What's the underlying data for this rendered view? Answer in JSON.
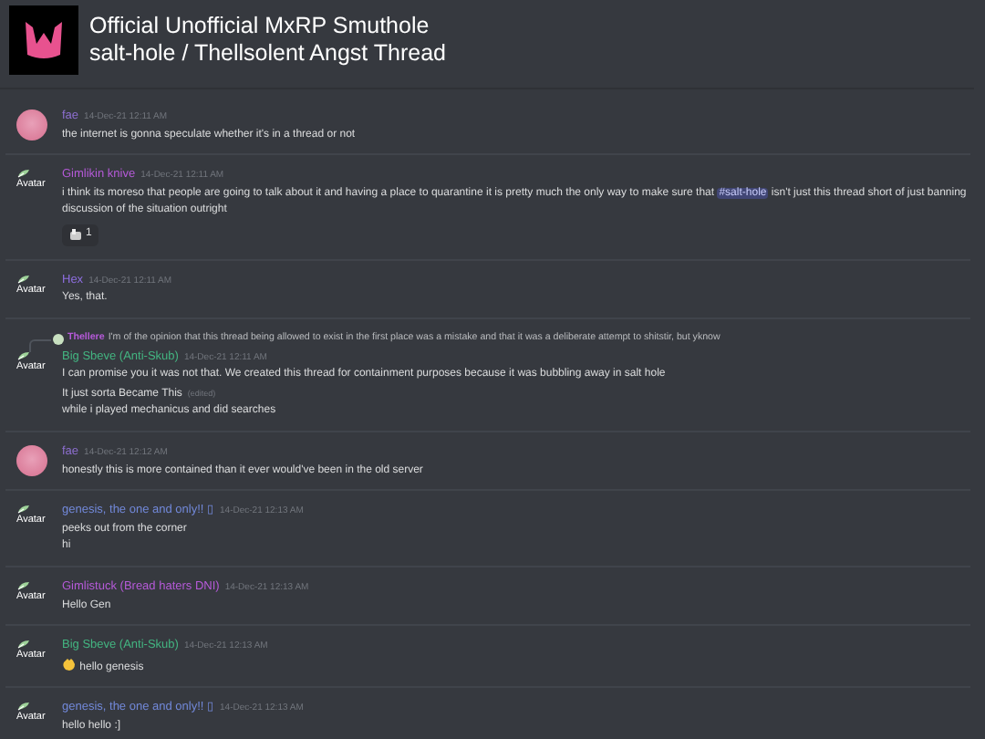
{
  "header": {
    "server": "Official Unofficial MxRP Smuthole",
    "channel": "salt-hole / Thellsolent Angst Thread"
  },
  "messages": [
    {
      "author": "fae",
      "color": "#8e6fd1",
      "avatar": {
        "kind": "photo"
      },
      "timestamp": "14-Dec-21 12:11 AM",
      "lines": [
        {
          "parts": [
            {
              "kind": "plain",
              "text": "the internet is gonna speculate whether it's in a thread or not"
            }
          ]
        }
      ]
    },
    {
      "author": "Gimlikin knive",
      "color": "#b65ad9",
      "avatar": {
        "kind": "broken",
        "alt": "Avatar"
      },
      "timestamp": "14-Dec-21 12:11 AM",
      "lines": [
        {
          "parts": [
            {
              "kind": "plain",
              "text": "i think its moreso that people are going to talk about it and having a place to quarantine it is pretty much the only way to make sure that "
            },
            {
              "kind": "mention",
              "text": "#salt-hole"
            },
            {
              "kind": "plain",
              "text": " isn't just this thread short of just banning discussion of the situation outright"
            }
          ]
        }
      ],
      "reaction": {
        "count": "1"
      }
    },
    {
      "author": "Hex",
      "color": "#8e6ee0",
      "avatar": {
        "kind": "broken",
        "alt": "Avatar"
      },
      "timestamp": "14-Dec-21 12:11 AM",
      "lines": [
        {
          "parts": [
            {
              "kind": "plain",
              "text": "Yes, that."
            }
          ]
        }
      ]
    },
    {
      "author": "Big Sbeve (Anti-Skub)",
      "color": "#43b581",
      "avatar": {
        "kind": "broken",
        "alt": "Avatar"
      },
      "timestamp": "14-Dec-21 12:11 AM",
      "reply": {
        "author": "Thellere",
        "color": "#b65ad9",
        "text": "I'm of the opinion that this thread being allowed to exist in the first place was a mistake and that it was a deliberate attempt to shitstir, but yknow"
      },
      "lines": [
        {
          "parts": [
            {
              "kind": "plain",
              "text": "I can promise you it was not that. We created this thread for containment purposes because it was bubbling away in salt hole"
            }
          ]
        },
        {
          "parts": [
            {
              "kind": "plain",
              "text": "It just sorta Became This"
            }
          ],
          "note": "(edited)"
        },
        {
          "parts": [
            {
              "kind": "plain",
              "text": "while i played mechanicus and did searches"
            }
          ]
        }
      ]
    },
    {
      "author": "fae",
      "color": "#8e6fd1",
      "avatar": {
        "kind": "photo"
      },
      "timestamp": "14-Dec-21 12:12 AM",
      "lines": [
        {
          "parts": [
            {
              "kind": "plain",
              "text": "honestly this is more contained than it ever would've been in the old server"
            }
          ]
        }
      ]
    },
    {
      "author": "genesis, the one and only!! ▯",
      "color": "#7289da",
      "avatar": {
        "kind": "broken",
        "alt": "Avatar"
      },
      "timestamp": "14-Dec-21 12:13 AM",
      "lines": [
        {
          "parts": [
            {
              "kind": "plain",
              "text": "peeks out from the corner"
            }
          ]
        },
        {
          "parts": [
            {
              "kind": "plain",
              "text": "hi"
            }
          ]
        }
      ]
    },
    {
      "author": "Gimlistuck (Bread haters DNI)",
      "color": "#b65ad9",
      "avatar": {
        "kind": "broken",
        "alt": "Avatar"
      },
      "timestamp": "14-Dec-21 12:13 AM",
      "lines": [
        {
          "parts": [
            {
              "kind": "plain",
              "text": "Hello Gen"
            }
          ]
        }
      ]
    },
    {
      "author": "Big Sbeve (Anti-Skub)",
      "color": "#43b581",
      "avatar": {
        "kind": "broken",
        "alt": "Avatar"
      },
      "timestamp": "14-Dec-21 12:13 AM",
      "lines": [
        {
          "parts": [
            {
              "kind": "wave-emoji"
            },
            {
              "kind": "plain",
              "text": " hello genesis"
            }
          ]
        }
      ]
    },
    {
      "author": "genesis, the one and only!! ▯",
      "color": "#7289da",
      "avatar": {
        "kind": "broken",
        "alt": "Avatar"
      },
      "timestamp": "14-Dec-21 12:13 AM",
      "lines": [
        {
          "parts": [
            {
              "kind": "plain",
              "text": "hello hello :]"
            }
          ]
        }
      ]
    }
  ]
}
